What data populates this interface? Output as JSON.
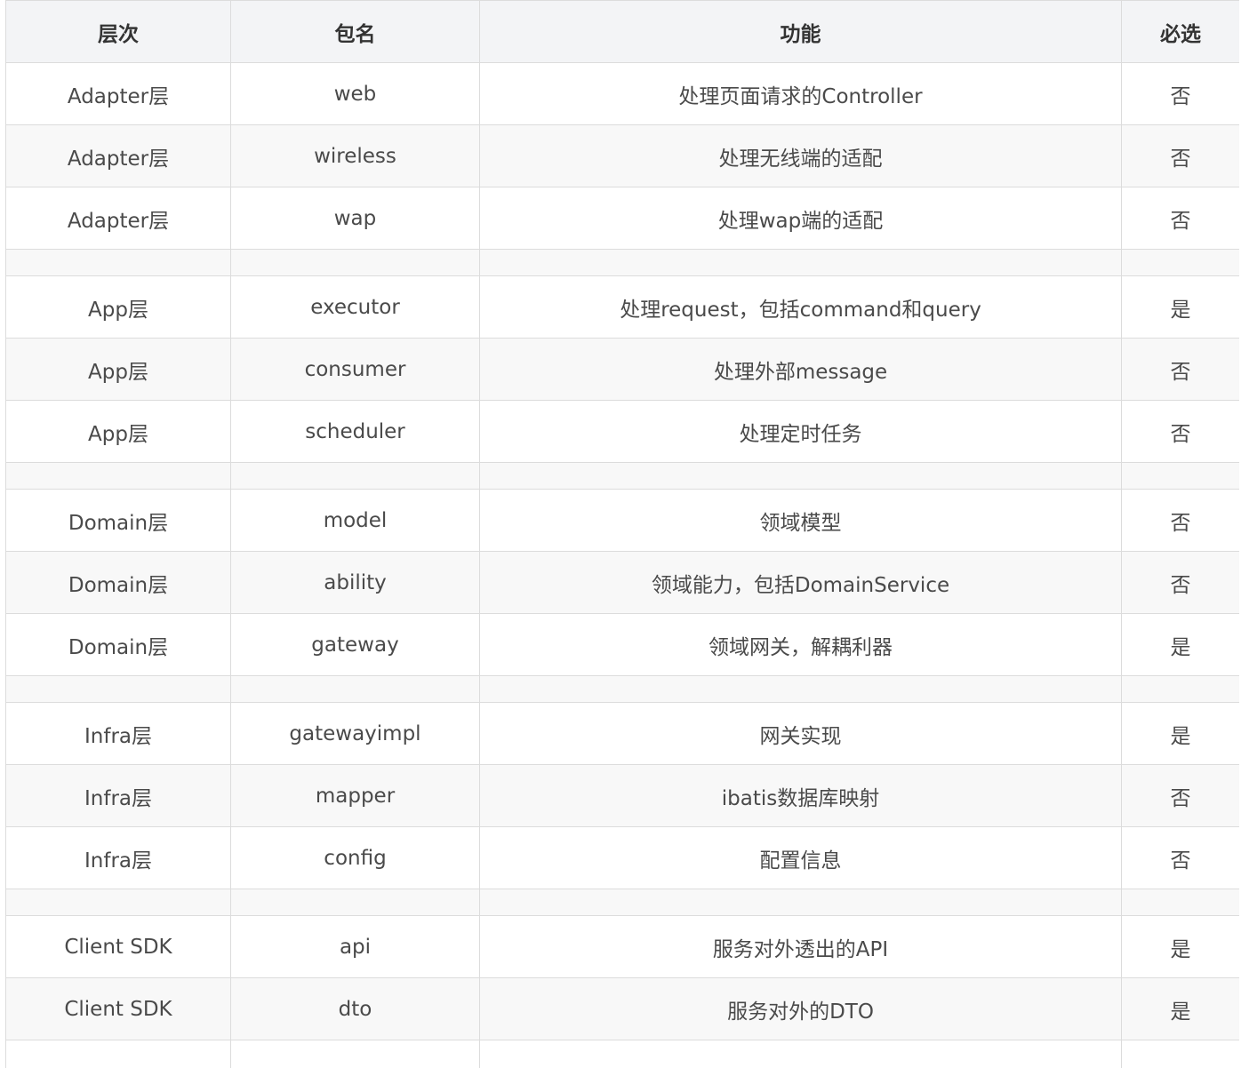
{
  "table": {
    "headers": [
      "层次",
      "包名",
      "功能",
      "必选"
    ],
    "rows": [
      {
        "layer": "Adapter层",
        "package": "web",
        "function": "处理页面请求的Controller",
        "required": "否"
      },
      {
        "layer": "Adapter层",
        "package": "wireless",
        "function": "处理无线端的适配",
        "required": "否"
      },
      {
        "layer": "Adapter层",
        "package": "wap",
        "function": "处理wap端的适配",
        "required": "否"
      },
      {
        "layer": "",
        "package": "",
        "function": "",
        "required": ""
      },
      {
        "layer": "App层",
        "package": "executor",
        "function": "处理request，包括command和query",
        "required": "是"
      },
      {
        "layer": "App层",
        "package": "consumer",
        "function": "处理外部message",
        "required": "否"
      },
      {
        "layer": "App层",
        "package": "scheduler",
        "function": "处理定时任务",
        "required": "否"
      },
      {
        "layer": "",
        "package": "",
        "function": "",
        "required": ""
      },
      {
        "layer": "Domain层",
        "package": "model",
        "function": "领域模型",
        "required": "否"
      },
      {
        "layer": "Domain层",
        "package": "ability",
        "function": "领域能力，包括DomainService",
        "required": "否"
      },
      {
        "layer": "Domain层",
        "package": "gateway",
        "function": "领域网关，解耦利器",
        "required": "是"
      },
      {
        "layer": "",
        "package": "",
        "function": "",
        "required": ""
      },
      {
        "layer": "Infra层",
        "package": "gatewayimpl",
        "function": "网关实现",
        "required": "是"
      },
      {
        "layer": "Infra层",
        "package": "mapper",
        "function": "ibatis数据库映射",
        "required": "否"
      },
      {
        "layer": "Infra层",
        "package": "config",
        "function": "配置信息",
        "required": "否"
      },
      {
        "layer": "",
        "package": "",
        "function": "",
        "required": ""
      },
      {
        "layer": "Client SDK",
        "package": "api",
        "function": "服务对外透出的API",
        "required": "是"
      },
      {
        "layer": "Client SDK",
        "package": "dto",
        "function": "服务对外的DTO",
        "required": "是"
      }
    ]
  }
}
